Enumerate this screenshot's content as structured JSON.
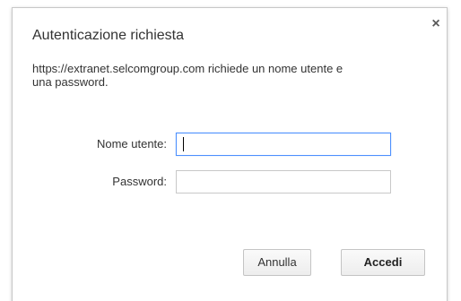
{
  "dialog": {
    "title": "Autenticazione richiesta",
    "message": "https://extranet.selcomgroup.com richiede un nome utente e una password.",
    "close_icon": "×",
    "username_label": "Nome utente:",
    "username_value": "",
    "password_label": "Password:",
    "password_value": "",
    "cancel_label": "Annulla",
    "ok_label": "Accedi"
  }
}
